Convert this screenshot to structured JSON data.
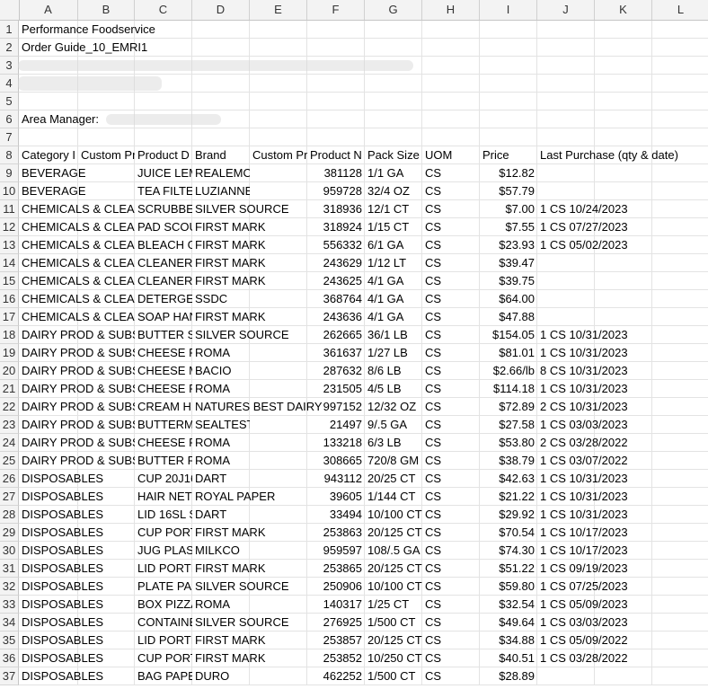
{
  "columns": [
    "A",
    "B",
    "C",
    "D",
    "E",
    "F",
    "G",
    "H",
    "I",
    "J",
    "K",
    "L"
  ],
  "header_rows": {
    "r1": "Performance Foodservice",
    "r2": "Order Guide_10_EMRI1",
    "r6": "Area Manager:"
  },
  "table_header": {
    "category": "Category I",
    "custom1": "Custom Pr",
    "product_desc": "Product D",
    "brand": "Brand",
    "custom2": "Custom Pr",
    "product_num": "Product N",
    "pack_size": "Pack Size",
    "uom": "UOM",
    "price": "Price",
    "last_purchase": "Last Purchase (qty & date)"
  },
  "rows": [
    {
      "n": "9",
      "cat": "BEVERAGE",
      "desc": "JUICE LEM",
      "brand": "REALEMON",
      "num": "381128",
      "pack": "1/1 GA",
      "uom": "CS",
      "price": "$12.82",
      "last": ""
    },
    {
      "n": "10",
      "cat": "BEVERAGE",
      "desc": "TEA FILTER",
      "brand": "LUZIANNE",
      "num": "959728",
      "pack": "32/4 OZ",
      "uom": "CS",
      "price": "$57.79",
      "last": ""
    },
    {
      "n": "11",
      "cat": "CHEMICALS & CLEAN",
      "desc": "SCRUBBER",
      "brand": "SILVER SOURCE",
      "num": "318936",
      "pack": "12/1 CT",
      "uom": "CS",
      "price": "$7.00",
      "last": "1 CS 10/24/2023"
    },
    {
      "n": "12",
      "cat": "CHEMICALS & CLEAN",
      "desc": "PAD SCOU",
      "brand": "FIRST MARK",
      "num": "318924",
      "pack": "1/15 CT",
      "uom": "CS",
      "price": "$7.55",
      "last": "1 CS 07/27/2023"
    },
    {
      "n": "13",
      "cat": "CHEMICALS & CLEAN",
      "desc": "BLEACH GI",
      "brand": "FIRST MARK",
      "num": "556332",
      "pack": "6/1 GA",
      "uom": "CS",
      "price": "$23.93",
      "last": "1 CS 05/02/2023"
    },
    {
      "n": "14",
      "cat": "CHEMICALS & CLEAN",
      "desc": "CLEANER (",
      "brand": "FIRST MARK",
      "num": "243629",
      "pack": "1/12 LT",
      "uom": "CS",
      "price": "$39.47",
      "last": ""
    },
    {
      "n": "15",
      "cat": "CHEMICALS & CLEAN",
      "desc": "CLEANER I",
      "brand": "FIRST MARK",
      "num": "243625",
      "pack": "4/1 GA",
      "uom": "CS",
      "price": "$39.75",
      "last": ""
    },
    {
      "n": "16",
      "cat": "CHEMICALS & CLEAN",
      "desc": "DETERGEN",
      "brand": "SSDC",
      "num": "368764",
      "pack": "4/1 GA",
      "uom": "CS",
      "price": "$64.00",
      "last": ""
    },
    {
      "n": "17",
      "cat": "CHEMICALS & CLEAN",
      "desc": "SOAP HAN",
      "brand": "FIRST MARK",
      "num": "243636",
      "pack": "4/1 GA",
      "uom": "CS",
      "price": "$47.88",
      "last": ""
    },
    {
      "n": "18",
      "cat": "DAIRY PROD & SUBS",
      "desc": "BUTTER SO",
      "brand": "SILVER SOURCE",
      "num": "262665",
      "pack": "36/1 LB",
      "uom": "CS",
      "price": "$154.05",
      "last": "1 CS 10/31/2023"
    },
    {
      "n": "19",
      "cat": "DAIRY PROD & SUBS",
      "desc": "CHEESE FE",
      "brand": "ROMA",
      "num": "361637",
      "pack": "1/27 LB",
      "uom": "CS",
      "price": "$81.01",
      "last": "1 CS 10/31/2023"
    },
    {
      "n": "20",
      "cat": "DAIRY PROD & SUBS",
      "desc": "CHEESE M",
      "brand": "BACIO",
      "num": "287632",
      "pack": "8/6 LB",
      "uom": "CS",
      "price": "$2.66/lb",
      "last": "8 CS 10/31/2023"
    },
    {
      "n": "21",
      "cat": "DAIRY PROD & SUBS",
      "desc": "CHEESE PE",
      "brand": "ROMA",
      "num": "231505",
      "pack": "4/5 LB",
      "uom": "CS",
      "price": "$114.18",
      "last": "1 CS 10/31/2023"
    },
    {
      "n": "22",
      "cat": "DAIRY PROD & SUBS",
      "desc": "CREAM HE",
      "brand": "NATURES BEST DAIRY",
      "num": "997152",
      "pack": "12/32 OZ",
      "uom": "CS",
      "price": "$72.89",
      "last": "2 CS 10/31/2023"
    },
    {
      "n": "23",
      "cat": "DAIRY PROD & SUBS",
      "desc": "BUTTERMI",
      "brand": "SEALTEST",
      "num": "21497",
      "pack": "9/.5 GA",
      "uom": "CS",
      "price": "$27.58",
      "last": "1 CS 03/03/2023"
    },
    {
      "n": "24",
      "cat": "DAIRY PROD & SUBS",
      "desc": "CHEESE RI",
      "brand": "ROMA",
      "num": "133218",
      "pack": "6/3 LB",
      "uom": "CS",
      "price": "$53.80",
      "last": "2 CS 03/28/2022"
    },
    {
      "n": "25",
      "cat": "DAIRY PROD & SUBS",
      "desc": "BUTTER RE",
      "brand": "ROMA",
      "num": "308665",
      "pack": "720/8 GM",
      "uom": "CS",
      "price": "$38.79",
      "last": "1 CS 03/07/2022"
    },
    {
      "n": "26",
      "cat": "DISPOSABLES",
      "desc": "CUP 20J16",
      "brand": "DART",
      "num": "943112",
      "pack": "20/25 CT",
      "uom": "CS",
      "price": "$42.63",
      "last": "1 CS 10/31/2023"
    },
    {
      "n": "27",
      "cat": "DISPOSABLES",
      "desc": "HAIR NET",
      "brand": "ROYAL PAPER",
      "num": "39605",
      "pack": "1/144 CT",
      "uom": "CS",
      "price": "$21.22",
      "last": "1 CS 10/31/2023"
    },
    {
      "n": "28",
      "cat": "DISPOSABLES",
      "desc": "LID 16SL ST",
      "brand": "DART",
      "num": "33494",
      "pack": "10/100 CT",
      "uom": "CS",
      "price": "$29.92",
      "last": "1 CS 10/31/2023"
    },
    {
      "n": "29",
      "cat": "DISPOSABLES",
      "desc": "CUP PORT",
      "brand": "FIRST MARK",
      "num": "253863",
      "pack": "20/125 CT",
      "uom": "CS",
      "price": "$70.54",
      "last": "1 CS 10/17/2023"
    },
    {
      "n": "30",
      "cat": "DISPOSABLES",
      "desc": "JUG PLAST",
      "brand": "MILKCO",
      "num": "959597",
      "pack": "108/.5 GA",
      "uom": "CS",
      "price": "$74.30",
      "last": "1 CS 10/17/2023"
    },
    {
      "n": "31",
      "cat": "DISPOSABLES",
      "desc": "LID PORTI",
      "brand": "FIRST MARK",
      "num": "253865",
      "pack": "20/125 CT",
      "uom": "CS",
      "price": "$51.22",
      "last": "1 CS 09/19/2023"
    },
    {
      "n": "32",
      "cat": "DISPOSABLES",
      "desc": "PLATE PAF",
      "brand": "SILVER SOURCE",
      "num": "250906",
      "pack": "10/100 CT",
      "uom": "CS",
      "price": "$59.80",
      "last": "1 CS 07/25/2023"
    },
    {
      "n": "33",
      "cat": "DISPOSABLES",
      "desc": "BOX PIZZA",
      "brand": "ROMA",
      "num": "140317",
      "pack": "1/25 CT",
      "uom": "CS",
      "price": "$32.54",
      "last": "1 CS 05/09/2023"
    },
    {
      "n": "34",
      "cat": "DISPOSABLES",
      "desc": "CONTAINE",
      "brand": "SILVER SOURCE",
      "num": "276925",
      "pack": "1/500 CT",
      "uom": "CS",
      "price": "$49.64",
      "last": "1 CS 03/03/2023"
    },
    {
      "n": "35",
      "cat": "DISPOSABLES",
      "desc": "LID PORTI",
      "brand": "FIRST MARK",
      "num": "253857",
      "pack": "20/125 CT",
      "uom": "CS",
      "price": "$34.88",
      "last": "1 CS 05/09/2022"
    },
    {
      "n": "36",
      "cat": "DISPOSABLES",
      "desc": "CUP PORT",
      "brand": "FIRST MARK",
      "num": "253852",
      "pack": "10/250 CT",
      "uom": "CS",
      "price": "$40.51",
      "last": "1 CS 03/28/2022"
    },
    {
      "n": "37",
      "cat": "DISPOSABLES",
      "desc": "BAG PAPE",
      "brand": "DURO",
      "num": "462252",
      "pack": "1/500 CT",
      "uom": "CS",
      "price": "$28.89",
      "last": ""
    }
  ]
}
